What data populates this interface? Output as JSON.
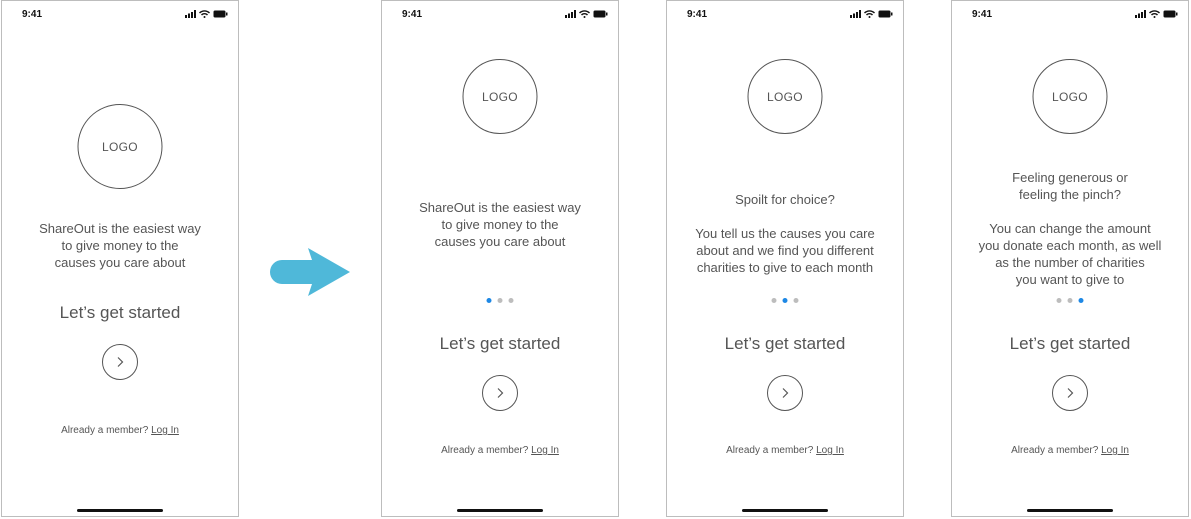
{
  "status": {
    "time": "9:41"
  },
  "logo_text": "LOGO",
  "cta": {
    "heading": "Let’s get started",
    "already_member": "Already a member?",
    "login": "Log In"
  },
  "screens": [
    {
      "body": "ShareOut is the easiest way\nto give money to the\ncauses you care about",
      "active_dot": null
    },
    {
      "body": "ShareOut is the easiest way\nto give money to the\ncauses you care about",
      "active_dot": 0
    },
    {
      "body": "Spoilt for choice?\n\nYou tell us the causes you care\nabout and we find you different\ncharities to give to each month",
      "active_dot": 1
    },
    {
      "body": "Feeling generous or\nfeeling the pinch?\n\nYou can change the amount\nyou donate each month, as well\nas the number of charities\nyou want to give to",
      "active_dot": 2
    }
  ],
  "colors": {
    "arrow": "#4fb8d9",
    "active_dot": "#1e88e5",
    "inactive_dot": "#bdbdbd"
  },
  "icons": {
    "flow_arrow": "arrow-right-icon",
    "next": "chevron-right-icon"
  }
}
